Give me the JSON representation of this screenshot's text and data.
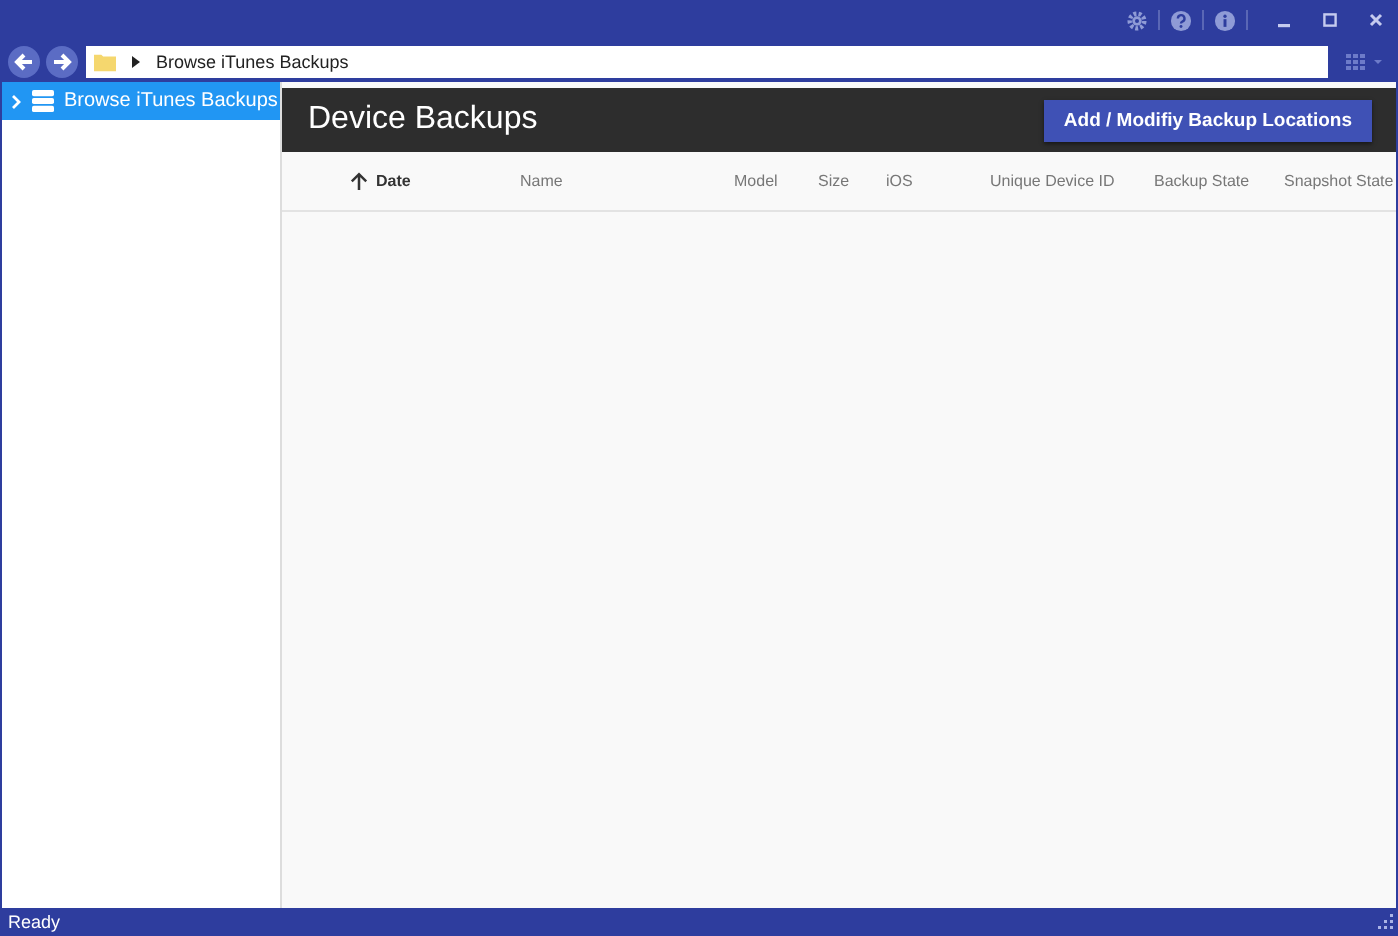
{
  "address_bar": {
    "path": "Browse iTunes Backups"
  },
  "sidebar": {
    "items": [
      {
        "label": "Browse iTunes Backups",
        "selected": true,
        "expanded": false
      }
    ]
  },
  "panel": {
    "title": "Device Backups",
    "button": "Add / Modifiy Backup Locations"
  },
  "table": {
    "columns": [
      {
        "label": "Date",
        "sorted": true
      },
      {
        "label": "Name",
        "sorted": false
      },
      {
        "label": "Model",
        "sorted": false
      },
      {
        "label": "Size",
        "sorted": false
      },
      {
        "label": "iOS",
        "sorted": false
      },
      {
        "label": "Unique Device ID",
        "sorted": false
      },
      {
        "label": "Backup State",
        "sorted": false
      },
      {
        "label": "Snapshot State",
        "sorted": false
      }
    ]
  },
  "status_bar": {
    "text": "Ready"
  }
}
